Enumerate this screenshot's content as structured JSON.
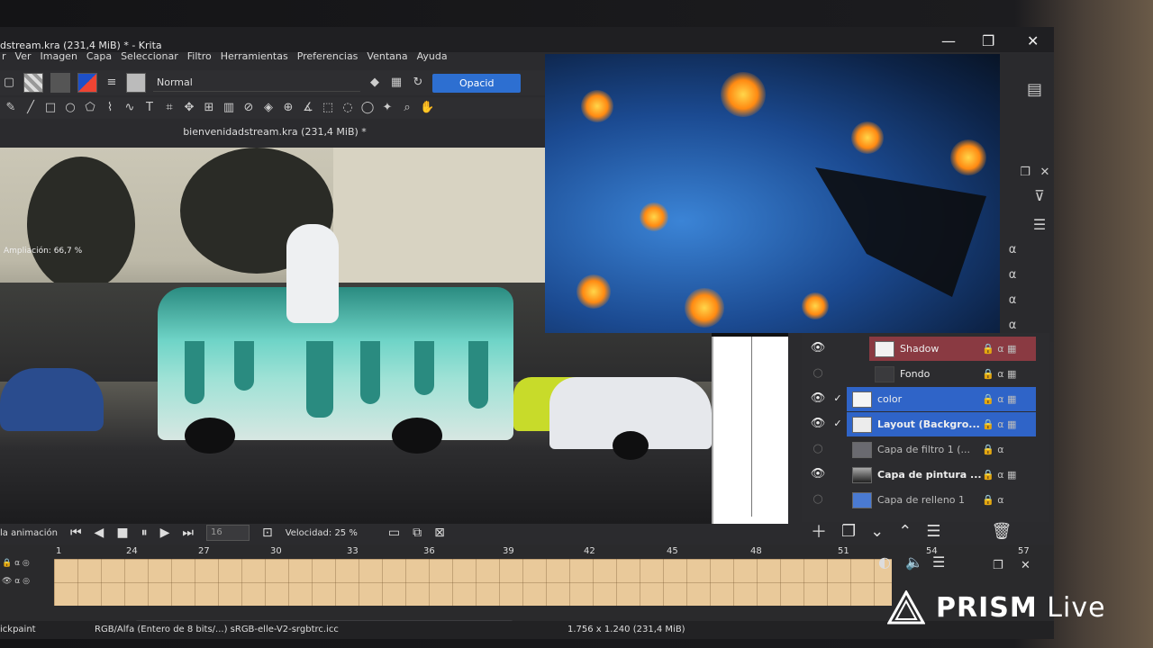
{
  "window": {
    "title": "dstream.kra (231,4 MiB) * - Krita",
    "minimize_glyph": "—",
    "maximize_glyph": "❐",
    "close_glyph": "✕"
  },
  "menu": [
    "Ver",
    "Imagen",
    "Capa",
    "Seleccionar",
    "Filtro",
    "Herramientas",
    "Preferencias",
    "Ventana",
    "Ayuda"
  ],
  "menu_partial_first": "r",
  "toolbar": {
    "blend_mode": "Normal",
    "opacity_label": "Opacid"
  },
  "document_tab": "bienvenidadstream.kra (231,4 MiB) *",
  "canvas": {
    "zoom_label": "Ampliación: 66,7 %"
  },
  "layers": [
    {
      "name": "Shadow",
      "visible": true,
      "checked": false,
      "state": "shadow"
    },
    {
      "name": "Fondo",
      "visible": false,
      "checked": false,
      "state": "normal"
    },
    {
      "name": "color",
      "visible": true,
      "checked": true,
      "state": "selected"
    },
    {
      "name": "Layout (Backgro...",
      "visible": true,
      "checked": true,
      "state": "selected"
    },
    {
      "name": "Capa de filtro 1 (...",
      "visible": false,
      "checked": false,
      "state": "normal"
    },
    {
      "name": "Capa de pintura ...",
      "visible": true,
      "checked": false,
      "state": "normal"
    },
    {
      "name": "Capa de relleno 1",
      "visible": false,
      "checked": false,
      "state": "normal"
    }
  ],
  "animation": {
    "label": "la animación",
    "frame_value": "16",
    "speed_label": "Velocidad: 25 %"
  },
  "timeline": {
    "frame_numbers": [
      "1",
      "24",
      "27",
      "30",
      "33",
      "36",
      "39",
      "42",
      "45",
      "48",
      "51",
      "54",
      "57"
    ]
  },
  "status": {
    "left": "ickpaint",
    "color_space": "RGB/Alfa (Entero de 8 bits/...)  sRGB-elle-V2-srgbtrc.icc",
    "size": "1.756 x 1.240 (231,4 MiB)"
  },
  "watermark": {
    "brand": "PRISM",
    "suffix": "Live"
  },
  "colors": {
    "accent": "#2f64c8",
    "shadow_layer": "#8a3a42",
    "timeline_frames": "#e9c99a"
  }
}
